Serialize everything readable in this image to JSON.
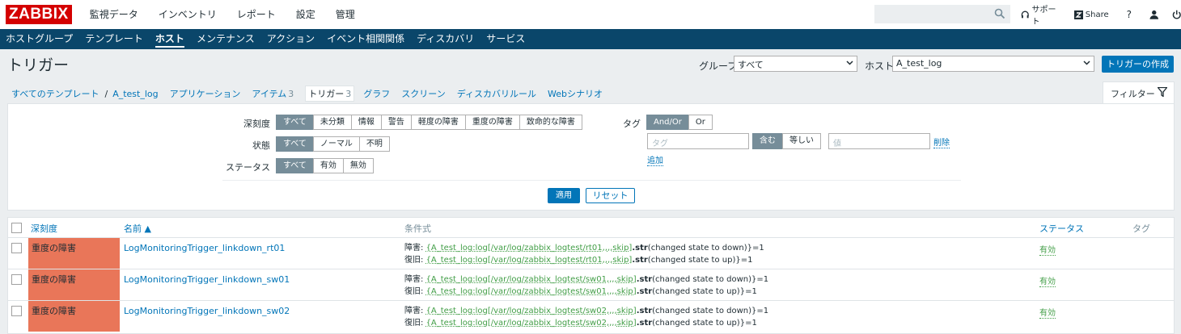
{
  "logo": "ZABBIX",
  "main_menu": [
    "監視データ",
    "インベントリ",
    "レポート",
    "設定",
    "管理"
  ],
  "top_icons": {
    "support": "サポート",
    "share": "Share",
    "help": "?"
  },
  "sub_menu": [
    "ホストグループ",
    "テンプレート",
    "ホスト",
    "メンテナンス",
    "アクション",
    "イベント相関関係",
    "ディスカバリ",
    "サービス"
  ],
  "page_title": "トリガー",
  "header": {
    "group_label": "グループ",
    "group_value": "すべて",
    "host_label": "ホスト",
    "host_value": "A_test_log",
    "create_button": "トリガーの作成"
  },
  "breadcrumbs": {
    "all_templates": "すべてのテンプレート",
    "separator": "/",
    "template": "A_test_log",
    "applications": "アプリケーション",
    "items": "アイテム",
    "items_count": "3",
    "triggers": "トリガー",
    "triggers_count": "3",
    "graphs": "グラフ",
    "screens": "スクリーン",
    "discovery": "ディスカバリルール",
    "web": "Webシナリオ"
  },
  "filter_tab": "フィルター",
  "filter": {
    "severity_label": "深刻度",
    "severity_options": [
      "すべて",
      "未分類",
      "情報",
      "警告",
      "軽度の障害",
      "重度の障害",
      "致命的な障害"
    ],
    "state_label": "状態",
    "state_options": [
      "すべて",
      "ノーマル",
      "不明"
    ],
    "status_label": "ステータス",
    "status_options": [
      "すべて",
      "有効",
      "無効"
    ],
    "tag_label": "タグ",
    "tag_mode_options": [
      "And/Or",
      "Or"
    ],
    "tag_placeholder": "タグ",
    "tag_op_options": [
      "含む",
      "等しい"
    ],
    "value_placeholder": "値",
    "remove_link": "削除",
    "add_link": "追加",
    "apply_button": "適用",
    "reset_button": "リセット"
  },
  "table": {
    "headers": {
      "severity": "深刻度",
      "name": "名前 ▲",
      "expression": "条件式",
      "status": "ステータス",
      "tags": "タグ"
    },
    "rows": [
      {
        "severity": "重度の障害",
        "name": "LogMonitoringTrigger_linkdown_rt01",
        "problem_prefix": "障害: ",
        "problem_key": "{A_test_log:log[/var/log/zabbix_logtest/rt01,,,,skip]",
        "problem_func": ".str",
        "problem_arg": "(changed state to down)",
        "problem_suffix": "}=1",
        "recovery_prefix": "復旧: ",
        "recovery_key": "{A_test_log:log[/var/log/zabbix_logtest/rt01,,,,skip]",
        "recovery_func": ".str",
        "recovery_arg": "(changed state to up)",
        "recovery_suffix": "}=1",
        "status": "有効"
      },
      {
        "severity": "重度の障害",
        "name": "LogMonitoringTrigger_linkdown_sw01",
        "problem_prefix": "障害: ",
        "problem_key": "{A_test_log:log[/var/log/zabbix_logtest/sw01,,,,skip]",
        "problem_func": ".str",
        "problem_arg": "(changed state to down)",
        "problem_suffix": "}=1",
        "recovery_prefix": "復旧: ",
        "recovery_key": "{A_test_log:log[/var/log/zabbix_logtest/sw01,,,,skip]",
        "recovery_func": ".str",
        "recovery_arg": "(changed state to up)",
        "recovery_suffix": "}=1",
        "status": "有効"
      },
      {
        "severity": "重度の障害",
        "name": "LogMonitoringTrigger_linkdown_sw02",
        "problem_prefix": "障害: ",
        "problem_key": "{A_test_log:log[/var/log/zabbix_logtest/sw02,,,,skip]",
        "problem_func": ".str",
        "problem_arg": "(changed state to down)",
        "problem_suffix": "}=1",
        "recovery_prefix": "復旧: ",
        "recovery_key": "{A_test_log:log[/var/log/zabbix_logtest/sw02,,,,skip]",
        "recovery_func": ".str",
        "recovery_arg": "(changed state to up)",
        "recovery_suffix": "}=1",
        "status": "有効"
      }
    ]
  },
  "colors": {
    "brand": "#d40000",
    "nav": "#0a466a",
    "primary": "#0275b8",
    "severity_high": "#e97659",
    "enabled": "#429e47"
  }
}
